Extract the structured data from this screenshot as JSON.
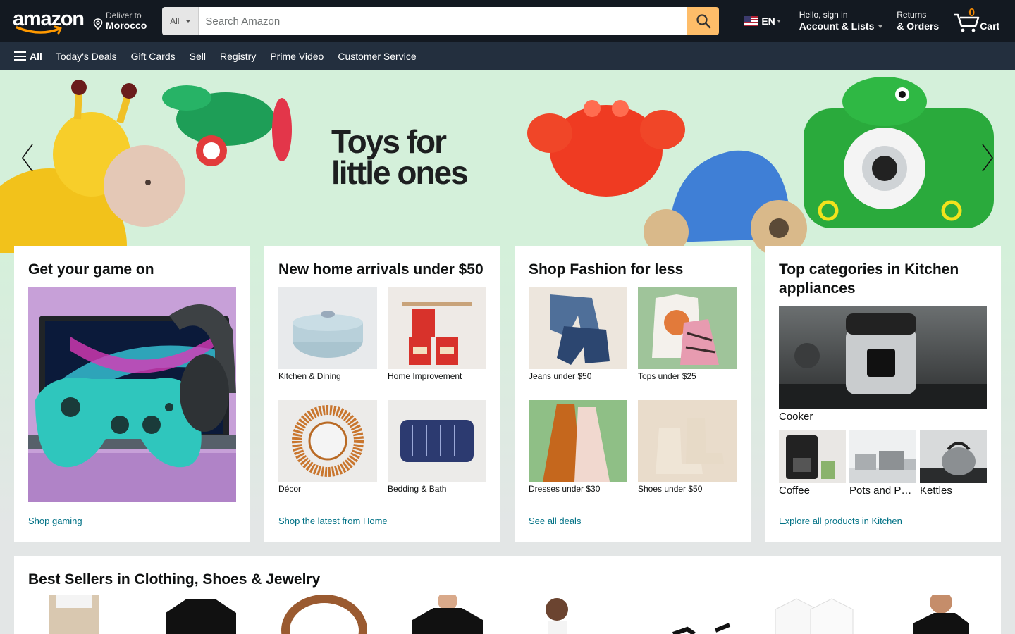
{
  "header": {
    "logo_text": "amazon",
    "deliver_line1": "Deliver to",
    "deliver_line2": "Morocco",
    "search_dept": "All",
    "search_placeholder": "Search Amazon",
    "language": "EN",
    "account_line1": "Hello, sign in",
    "account_line2": "Account & Lists",
    "returns_line1": "Returns",
    "returns_line2": "& Orders",
    "cart_count": "0",
    "cart_label": "Cart"
  },
  "subnav": {
    "all_label": "All",
    "items": [
      "Today's Deals",
      "Gift Cards",
      "Sell",
      "Registry",
      "Prime Video",
      "Customer Service"
    ]
  },
  "hero": {
    "title_line1": "Toys for",
    "title_line2": "little ones"
  },
  "cards": [
    {
      "title": "Get your game on",
      "link": "Shop gaming"
    },
    {
      "title": "New home arrivals under $50",
      "items": [
        "Kitchen & Dining",
        "Home Improvement",
        "Décor",
        "Bedding & Bath"
      ],
      "link": "Shop the latest from Home"
    },
    {
      "title": "Shop Fashion for less",
      "items": [
        "Jeans under $50",
        "Tops under $25",
        "Dresses under $30",
        "Shoes under $50"
      ],
      "link": "See all deals"
    },
    {
      "title": "Top categories in Kitchen appliances",
      "main_item": "Cooker",
      "items": [
        "Coffee",
        "Pots and Pans",
        "Kettles"
      ],
      "link": "Explore all products in Kitchen"
    }
  ],
  "best_sellers": {
    "title": "Best Sellers in Clothing, Shoes & Jewelry"
  },
  "colors": {
    "nav_dark": "#131921",
    "nav_sub": "#232f3e",
    "search_button": "#febd69",
    "cart_count": "#f08804",
    "link": "#007185",
    "hero_bg": "#d4f0da"
  }
}
